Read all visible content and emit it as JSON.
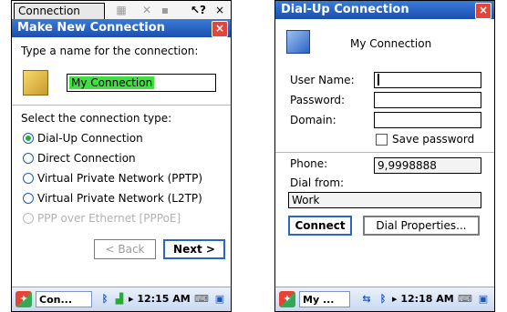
{
  "screen1": {
    "tab_label": "Connection",
    "dialog_title": "Make New Connection",
    "close_label": "×",
    "name_prompt": "Type a name for the connection:",
    "name_value": "My Connection",
    "type_prompt": "Select the connection type:",
    "options": [
      {
        "label": "Dial-Up Connection",
        "selected": true,
        "enabled": true
      },
      {
        "label": "Direct Connection",
        "selected": false,
        "enabled": true
      },
      {
        "label": "Virtual Private Network (PPTP)",
        "selected": false,
        "enabled": true
      },
      {
        "label": "Virtual Private Network (L2TP)",
        "selected": false,
        "enabled": true
      },
      {
        "label": "PPP over Ethernet [PPPoE]",
        "selected": false,
        "enabled": false
      }
    ],
    "back_label": "< Back",
    "next_label": "Next >",
    "taskbar": {
      "task_label": "Con...",
      "clock": "12:15 AM"
    }
  },
  "screen2": {
    "dialog_title": "Dial-Up Connection",
    "close_label": "×",
    "connection_name": "My Connection",
    "user_name_label": "User Name:",
    "password_label": "Password:",
    "domain_label": "Domain:",
    "save_password_label": "Save password",
    "phone_label": "Phone:",
    "phone_value": "9,9998888",
    "dial_from_label": "Dial from:",
    "dial_from_value": "Work",
    "connect_label": "Connect",
    "dial_properties_label": "Dial Properties...",
    "taskbar": {
      "task_label": "My ...",
      "clock": "12:18 AM"
    }
  },
  "colors": {
    "titlebar": "#1b4fb0",
    "close": "#e0473a",
    "highlight": "#3fe03f",
    "default_button_border": "#2a66c9"
  }
}
